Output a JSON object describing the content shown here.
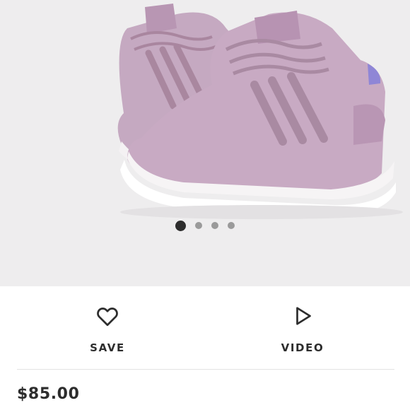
{
  "product": {
    "image_icon": "sneaker-photo",
    "brand_mark": "adidas",
    "accent_color": "#c8aac3",
    "carousel": {
      "total": 4,
      "active_index": 0
    }
  },
  "actions": {
    "save_label": "SAVE",
    "save_icon": "heart-icon",
    "video_label": "VIDEO",
    "video_icon": "play-icon"
  },
  "price": "$85.00"
}
